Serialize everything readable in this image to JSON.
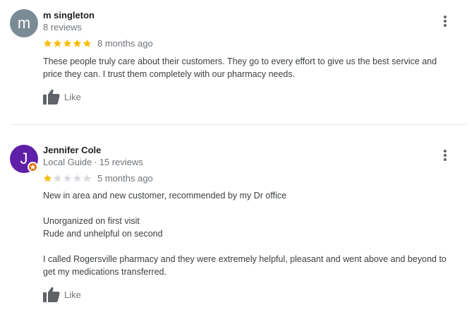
{
  "reviews": [
    {
      "avatar_letter": "m",
      "name": "m singleton",
      "stats": "8 reviews",
      "local_guide": "",
      "rating": 5,
      "time_ago": "8 months ago",
      "text_lines": [
        "These people truly care about their customers. They go to every effort to give us the best service and",
        "price they can. I trust them completely with our pharmacy needs."
      ],
      "like_label": "Like"
    },
    {
      "avatar_letter": "J",
      "name": "Jennifer Cole",
      "local_guide": "Local Guide",
      "stats": "15 reviews",
      "rating": 1,
      "time_ago": "5 months ago",
      "text_lines": [
        "New in area and new customer, recommended by my Dr office",
        "",
        "Unorganized on first visit",
        "Rude and unhelpful on second",
        "",
        "I called Rogersville pharmacy and they were extremely helpful, pleasant and went above and beyond to",
        "get my medications transferred."
      ],
      "like_label": "Like"
    }
  ],
  "colors": {
    "star_filled": "#fbbc04",
    "star_empty": "#dadce0",
    "avatar_1": "#7b8b96",
    "avatar_2": "#5f1fa8",
    "local_guide_badge": "#e8710a"
  },
  "icons": {
    "menu": "more-vert-icon",
    "like": "thumb-up-icon",
    "badge": "local-guide-badge-icon"
  }
}
